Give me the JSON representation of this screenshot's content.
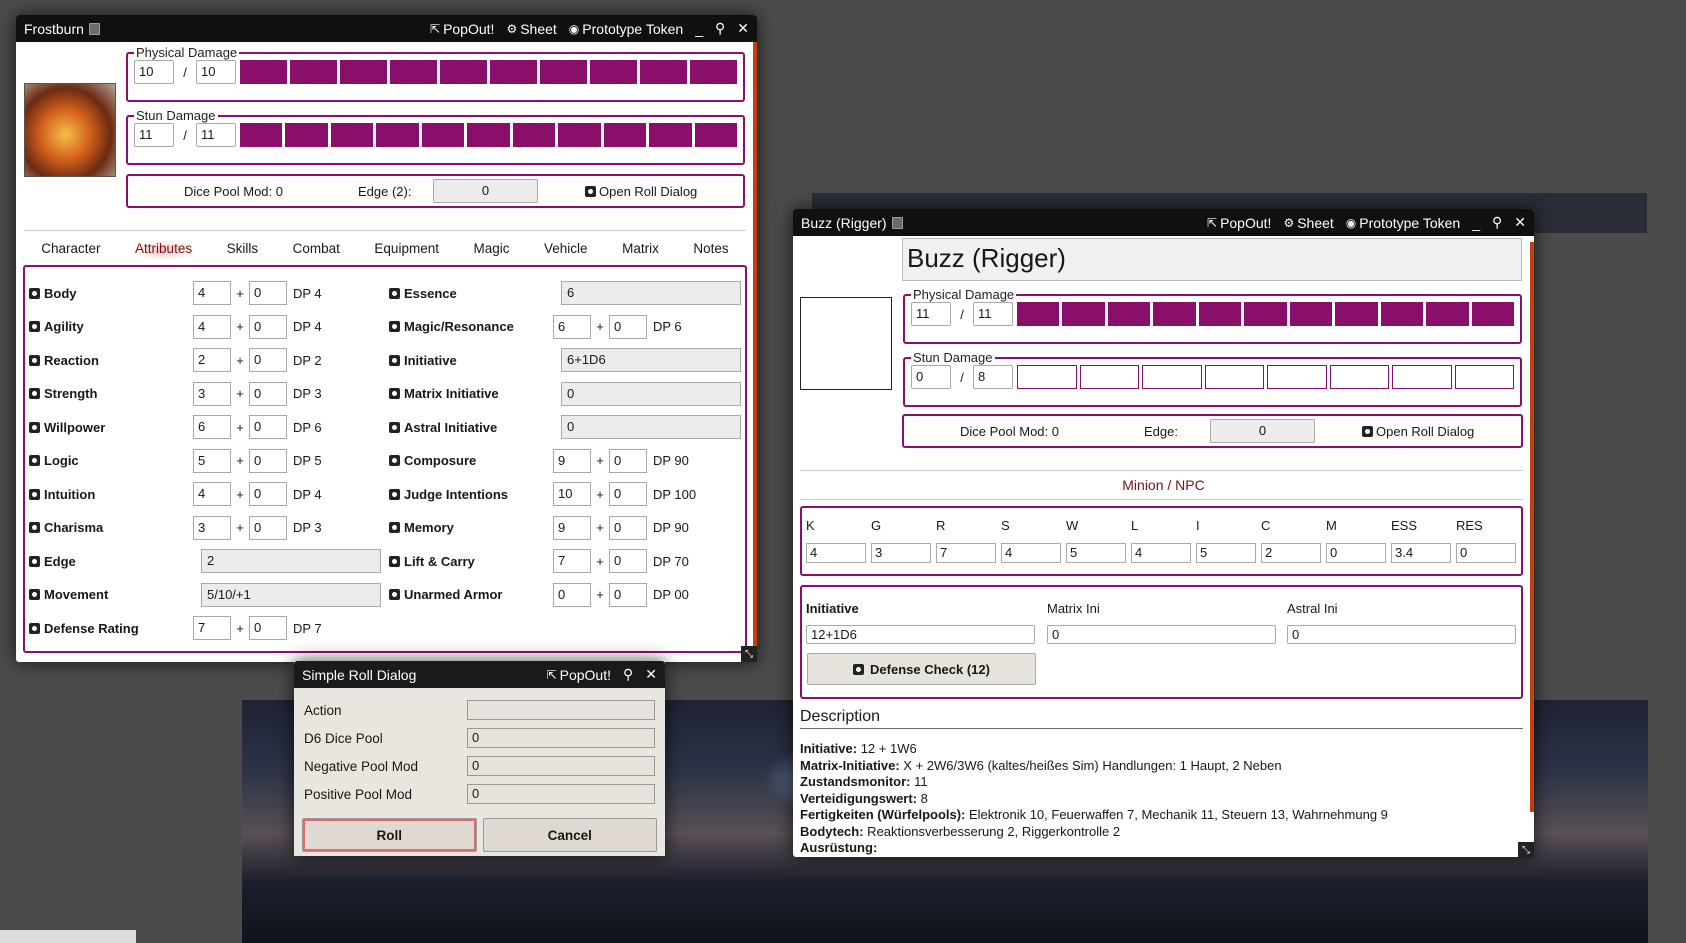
{
  "frostburn": {
    "title": "Frostburn",
    "controls": {
      "popout": "PopOut!",
      "sheet": "Sheet",
      "token": "Prototype Token",
      "minimize": "_"
    },
    "physical": {
      "legend": "Physical Damage",
      "cur": "10",
      "max": "10",
      "filled": 10,
      "total": 10
    },
    "stun": {
      "legend": "Stun Damage",
      "cur": "11",
      "max": "11",
      "filled": 11,
      "total": 11
    },
    "dicepool_label": "Dice Pool Mod: 0",
    "edge_label": "Edge (2):",
    "edge_value": "0",
    "open_roll": "Open Roll Dialog",
    "tabs": [
      "Character",
      "Attributes",
      "Skills",
      "Combat",
      "Equipment",
      "Magic",
      "Vehicle",
      "Matrix",
      "Notes"
    ],
    "left_attrs": [
      {
        "label": "Body",
        "base": "4",
        "mod": "0",
        "dp": "DP 4"
      },
      {
        "label": "Agility",
        "base": "4",
        "mod": "0",
        "dp": "DP 4"
      },
      {
        "label": "Reaction",
        "base": "2",
        "mod": "0",
        "dp": "DP 2"
      },
      {
        "label": "Strength",
        "base": "3",
        "mod": "0",
        "dp": "DP 3"
      },
      {
        "label": "Willpower",
        "base": "6",
        "mod": "0",
        "dp": "DP 6"
      },
      {
        "label": "Logic",
        "base": "5",
        "mod": "0",
        "dp": "DP 5"
      },
      {
        "label": "Intuition",
        "base": "4",
        "mod": "0",
        "dp": "DP 4"
      },
      {
        "label": "Charisma",
        "base": "3",
        "mod": "0",
        "dp": "DP 3"
      }
    ],
    "edge": {
      "label": "Edge",
      "value": "2"
    },
    "movement": {
      "label": "Movement",
      "value": "5/10/+1"
    },
    "defense": {
      "label": "Defense Rating",
      "base": "7",
      "mod": "0",
      "dp": "DP 7"
    },
    "right_single": [
      {
        "label": "Essence",
        "value": "6"
      }
    ],
    "magic": {
      "label": "Magic/Resonance",
      "base": "6",
      "mod": "0",
      "dp": "DP 6"
    },
    "right_single2": [
      {
        "label": "Initiative",
        "value": "6+1D6"
      },
      {
        "label": "Matrix Initiative",
        "value": "0"
      },
      {
        "label": "Astral Initiative",
        "value": "0"
      }
    ],
    "right_attrs": [
      {
        "label": "Composure",
        "base": "9",
        "mod": "0",
        "dp": "DP 90"
      },
      {
        "label": "Judge Intentions",
        "base": "10",
        "mod": "0",
        "dp": "DP 100"
      },
      {
        "label": "Memory",
        "base": "9",
        "mod": "0",
        "dp": "DP 90"
      },
      {
        "label": "Lift & Carry",
        "base": "7",
        "mod": "0",
        "dp": "DP 70"
      },
      {
        "label": "Unarmed Armor",
        "base": "0",
        "mod": "0",
        "dp": "DP 00"
      }
    ]
  },
  "buzz": {
    "title": "Buzz (Rigger)",
    "controls": {
      "popout": "PopOut!",
      "sheet": "Sheet",
      "token": "Prototype Token",
      "minimize": "_"
    },
    "name": "Buzz (Rigger)",
    "physical": {
      "legend": "Physical Damage",
      "cur": "11",
      "max": "11",
      "filled": 11,
      "total": 11
    },
    "stun": {
      "legend": "Stun Damage",
      "cur": "0",
      "max": "8",
      "filled": 0,
      "total": 8
    },
    "dicepool_label": "Dice Pool Mod: 0",
    "edge_label": "Edge:",
    "edge_value": "0",
    "open_roll": "Open Roll Dialog",
    "type_label": "Minion / NPC",
    "stats": [
      {
        "k": "K",
        "v": "4"
      },
      {
        "k": "G",
        "v": "3"
      },
      {
        "k": "R",
        "v": "7"
      },
      {
        "k": "S",
        "v": "4"
      },
      {
        "k": "W",
        "v": "5"
      },
      {
        "k": "L",
        "v": "4"
      },
      {
        "k": "I",
        "v": "5"
      },
      {
        "k": "C",
        "v": "2"
      },
      {
        "k": "M",
        "v": "0"
      },
      {
        "k": "ESS",
        "v": "3.4"
      },
      {
        "k": "RES",
        "v": "0"
      }
    ],
    "ini_label": "Initiative",
    "ini_value": "12+1D6",
    "matrix_label": "Matrix Ini",
    "matrix_value": "0",
    "astral_label": "Astral Ini",
    "astral_value": "0",
    "defense_btn": "Defense Check (12)",
    "desc_heading": "Description",
    "desc": [
      {
        "b": "Initiative:",
        "t": " 12 + 1W6"
      },
      {
        "b": "Matrix-Initiative:",
        "t": " X + 2W6/3W6 (kaltes/heißes Sim) Handlungen: 1 Haupt, 2 Neben"
      },
      {
        "b": "Zustandsmonitor:",
        "t": " 11"
      },
      {
        "b": "Verteidigungswert:",
        "t": " 8"
      },
      {
        "b": "Fertigkeiten (Würfelpools):",
        "t": " Elektronik 10, Feuerwaffen 7, Mechanik 11, Steuern 13, Wahrnehmung 9"
      },
      {
        "b": "Bodytech:",
        "t": " Reaktionsverbesserung 2, Riggerkontrolle 2"
      },
      {
        "b": "Ausrüstung:",
        "t": ""
      }
    ]
  },
  "roll": {
    "title": "Simple Roll Dialog",
    "popout": "PopOut!",
    "fields": [
      {
        "label": "Action",
        "value": ""
      },
      {
        "label": "D6 Dice Pool",
        "value": "0"
      },
      {
        "label": "Negative Pool Mod",
        "value": "0"
      },
      {
        "label": "Positive Pool Mod",
        "value": "0"
      }
    ],
    "roll_btn": "Roll",
    "cancel_btn": "Cancel"
  },
  "colors": {
    "accent": "#8a0f6b",
    "titlebar": "#101010"
  },
  "icons": [
    "external-link-icon",
    "gear-icon",
    "user-circle-icon",
    "pin-icon",
    "close-icon",
    "dice-icon",
    "book-icon",
    "resize-icon"
  ]
}
